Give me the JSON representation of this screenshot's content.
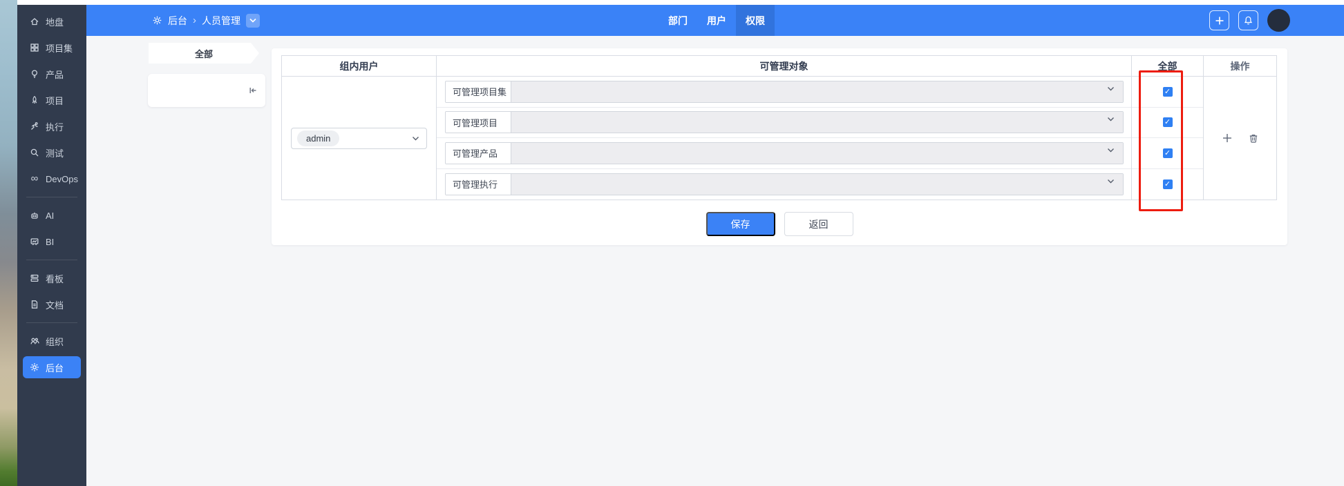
{
  "navbar": {
    "breadcrumb": {
      "root": "后台",
      "separator": "›",
      "current": "人员管理"
    },
    "tabs": [
      {
        "label": "部门"
      },
      {
        "label": "用户"
      },
      {
        "label": "权限"
      }
    ]
  },
  "sidebar": {
    "items": [
      {
        "label": "地盘"
      },
      {
        "label": "项目集"
      },
      {
        "label": "产品"
      },
      {
        "label": "项目"
      },
      {
        "label": "执行"
      },
      {
        "label": "测试"
      },
      {
        "label": "DevOps"
      },
      {
        "label": "AI"
      },
      {
        "label": "BI"
      },
      {
        "label": "看板"
      },
      {
        "label": "文档"
      },
      {
        "label": "组织"
      },
      {
        "label": "后台"
      }
    ],
    "devops_icon_glyph": "∞"
  },
  "filter_panel": {
    "all_label": "全部"
  },
  "table": {
    "headers": [
      "组内用户",
      "可管理对象",
      "全部",
      "操作"
    ],
    "row": {
      "group_user": {
        "value": "admin"
      },
      "objects": [
        {
          "label": "可管理项目集",
          "checked": true
        },
        {
          "label": "可管理项目",
          "checked": true
        },
        {
          "label": "可管理产品",
          "checked": true
        },
        {
          "label": "可管理执行",
          "checked": true
        }
      ]
    }
  },
  "footer_buttons": {
    "save": "保存",
    "back": "返回"
  },
  "colors": {
    "navbar_blue": "#3a82f7",
    "navbar_active_tab": "#3173dd",
    "sidebar_dark": "#313b4d",
    "active_item_blue": "#3b82f6",
    "checkbox_blue": "#2f80f3",
    "highlight_red": "#ed1c0f",
    "save_button_blue": "#3b82f6"
  }
}
